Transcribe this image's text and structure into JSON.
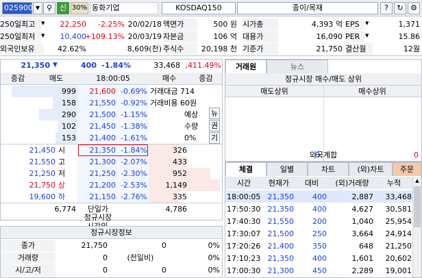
{
  "toolbar": {
    "code": "025900",
    "badge_sin": "신",
    "badge_pct": "30%",
    "name": "동화기업",
    "market": "KOSDAQ150",
    "sector": "종이/목재"
  },
  "info": {
    "row1": {
      "l1": "250일최고",
      "v1": "22,250",
      "p1": "-2.25%",
      "d1": "20/02/18",
      "l2": "액면가",
      "v2": "500 원",
      "l3": "시가총",
      "v3": "4,393 억",
      "l4": "EPS",
      "v4": "1,371"
    },
    "row2": {
      "l1": "250일최저",
      "v1": "10,400",
      "p1": "+109.13%",
      "d1": "20/03/19",
      "l2": "자본금",
      "v2": "106 억",
      "l3": "대용가",
      "v3": "16,090",
      "l4": "PER",
      "v4": "15.86"
    },
    "row3": {
      "l1": "외국인보유",
      "v1": "42.62%",
      "v1b": "8,609(천)",
      "l2": "주식수",
      "v2": "20,198 천",
      "l3": "기준가",
      "v3": "21,750",
      "l4": "결산월",
      "v4": "12월"
    }
  },
  "quote": {
    "price": "21,350",
    "arrow": "▼",
    "change": "400",
    "rate": "-1.84%",
    "volume": "33,468",
    "vol_rate": ",411.49%"
  },
  "orderbook": {
    "headers": [
      "증감",
      "매도",
      "18:00:05",
      "매수",
      "증감"
    ],
    "asks": [
      {
        "qty": "999",
        "price": "21,600",
        "rate": "-0.69%"
      },
      {
        "qty": "158",
        "price": "21,550",
        "rate": "-0.92%"
      },
      {
        "qty": "290",
        "price": "21,500",
        "rate": "-1.15%"
      },
      {
        "qty": "102",
        "price": "21,450",
        "rate": "-1.38%"
      },
      {
        "qty": "153",
        "price": "21,400",
        "rate": "-1.61%"
      }
    ],
    "bids": [
      {
        "price": "21,350",
        "rate": "-1.84%",
        "qty": "326"
      },
      {
        "price": "21,300",
        "rate": "-2.07%",
        "qty": "433"
      },
      {
        "price": "21,250",
        "rate": "-2.30%",
        "qty": "952"
      },
      {
        "price": "21,200",
        "rate": "-2.53%",
        "qty": "1,149"
      },
      {
        "price": "21,150",
        "rate": "-2.76%",
        "qty": "335"
      }
    ],
    "side_info": {
      "amt_label": "거래대금",
      "amt": "714",
      "cost_label": "거래비용",
      "cost": "60원",
      "expect": "예상",
      "qty": "수량",
      "zero": "0%",
      "news": "뉴",
      "right": "권",
      "gi": "기"
    },
    "ohlc": [
      {
        "price": "21,450",
        "label": "시"
      },
      {
        "price": "21,550",
        "label": "고"
      },
      {
        "price": "21,250",
        "label": "저"
      },
      {
        "price": "21,750",
        "label": "상"
      },
      {
        "price": "19,600",
        "label": "하"
      }
    ],
    "total_ask": "6,774",
    "total_bid": "4,786",
    "single": "단일가",
    "regular": "정규시장",
    "after": "시간외"
  },
  "regular_info": {
    "title": "정규시장정보",
    "rows": [
      {
        "label": "종가",
        "v1": "21,750",
        "v2": "0",
        "v3": "0%"
      },
      {
        "label": "거래량",
        "v1": "0",
        "v2": "(전일비)",
        "v3": "0%"
      },
      {
        "label": "시/고/저",
        "v1": "0",
        "v2": "0",
        "v3": "0%"
      }
    ]
  },
  "broker": {
    "tab1": "거래원",
    "tab2": "뉴스",
    "title": "정규시장 매수/매도 상위",
    "col1": "매도상위",
    "col2": "매수상위",
    "left_total": "0",
    "mid_label": "외국계합",
    "right_total": "0"
  },
  "trades": {
    "tabs": [
      "체결",
      "일별",
      "차트",
      "(외)차트",
      "주문"
    ],
    "headers": [
      "시간",
      "현재가",
      "대비",
      "(외)거래량",
      "누적"
    ],
    "rows": [
      {
        "time": "18:00:05",
        "price": "21,350",
        "diff": "400",
        "vol": "2,887",
        "cum": "33,468"
      },
      {
        "time": "17:50:30",
        "price": "21,350",
        "diff": "400",
        "vol": "4,627",
        "cum": "30,581"
      },
      {
        "time": "17:40:30",
        "price": "21,550",
        "diff": "200",
        "vol": "1,040",
        "cum": "25,954"
      },
      {
        "time": "17:30:07",
        "price": "21,500",
        "diff": "250",
        "vol": "3,664",
        "cum": "24,914"
      },
      {
        "time": "17:20:26",
        "price": "21,400",
        "diff": "350",
        "vol": "648",
        "cum": "21,250"
      },
      {
        "time": "17:10:23",
        "price": "21,350",
        "diff": "400",
        "vol": "1,601",
        "cum": "20,602"
      },
      {
        "time": "17:00:30",
        "price": "21,300",
        "diff": "450",
        "vol": "2,289",
        "cum": "19,001"
      }
    ]
  },
  "colors": {
    "up": "#e0001b",
    "down": "#1a3fe0",
    "header_bg": "#eef0f4"
  }
}
